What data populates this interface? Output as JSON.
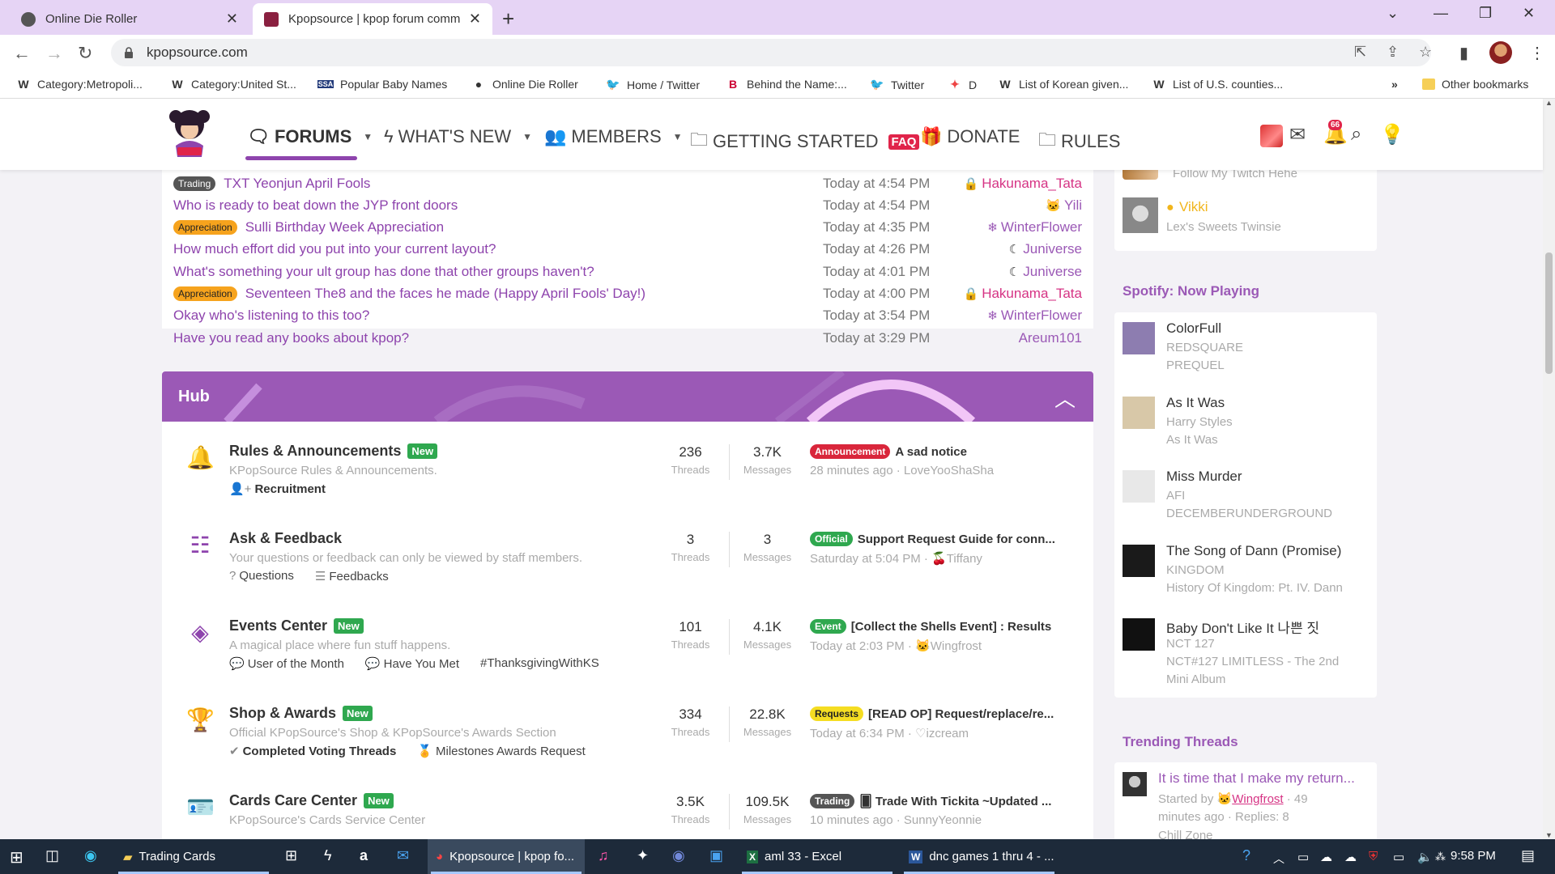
{
  "browser": {
    "tabs": [
      {
        "title": "Online Die Roller",
        "active": false
      },
      {
        "title": "Kpopsource | kpop forum comm",
        "active": true
      }
    ],
    "url": "kpopsource.com",
    "bookmarks": [
      {
        "icon": "W",
        "label": "Category:Metropoli..."
      },
      {
        "icon": "W",
        "label": "Category:United St..."
      },
      {
        "icon": "SSA",
        "label": "Popular Baby Names"
      },
      {
        "icon": "●",
        "label": "Online Die Roller"
      },
      {
        "icon": "🐦",
        "label": "Home / Twitter"
      },
      {
        "icon": "B",
        "label": "Behind the Name:..."
      },
      {
        "icon": "🐦",
        "label": "Twitter"
      },
      {
        "icon": "✦",
        "label": "D"
      },
      {
        "icon": "W",
        "label": "List of Korean given..."
      },
      {
        "icon": "W",
        "label": "List of U.S. counties..."
      }
    ],
    "more_bookmarks": "»",
    "other_bookmarks": "Other bookmarks"
  },
  "nav": {
    "forums": "FORUMS",
    "whats_new": "WHAT'S NEW",
    "members": "MEMBERS",
    "getting_started": "GETTING STARTED",
    "faq": "FAQ",
    "donate": "DONATE",
    "rules": "RULES",
    "alerts_count": "66"
  },
  "new_posts": [
    {
      "label": "Trading",
      "label_type": "trading",
      "title": "TXT Yeonjun April Fools",
      "time": "Today at 4:54 PM",
      "user": "Hakunama_Tata",
      "user_color": "#d63384",
      "user_icon": "lock-icon"
    },
    {
      "label": "",
      "label_type": "",
      "title": "Who is ready to beat down the JYP front doors",
      "time": "Today at 4:54 PM",
      "user": "Yili",
      "user_color": "#9b59b6",
      "user_icon": "cat-icon"
    },
    {
      "label": "Appreciation",
      "label_type": "appreciation",
      "title": "Sulli Birthday Week Appreciation",
      "time": "Today at 4:35 PM",
      "user": "WinterFlower",
      "user_color": "#9b59b6",
      "user_icon": "snowflake-icon"
    },
    {
      "label": "",
      "label_type": "",
      "title": "How much effort did you put into your current layout?",
      "time": "Today at 4:26 PM",
      "user": "Juniverse",
      "user_color": "#9b59b6",
      "user_icon": "moon-icon"
    },
    {
      "label": "",
      "label_type": "",
      "title": "What's something your ult group has done that other groups haven't?",
      "time": "Today at 4:01 PM",
      "user": "Juniverse",
      "user_color": "#9b59b6",
      "user_icon": "moon-icon"
    },
    {
      "label": "Appreciation",
      "label_type": "appreciation",
      "title": "Seventeen The8 and the faces he made (Happy April Fools' Day!)",
      "time": "Today at 4:00 PM",
      "user": "Hakunama_Tata",
      "user_color": "#d63384",
      "user_icon": "lock-icon"
    },
    {
      "label": "",
      "label_type": "",
      "title": "Okay who's listening to this too?",
      "time": "Today at 3:54 PM",
      "user": "WinterFlower",
      "user_color": "#9b59b6",
      "user_icon": "snowflake-icon"
    },
    {
      "label": "",
      "label_type": "",
      "title": "Have you read any books about kpop?",
      "time": "Today at 3:29 PM",
      "user": "Areum101",
      "user_color": "#9b59b6",
      "user_icon": ""
    }
  ],
  "hub": {
    "title": "Hub",
    "forums": [
      {
        "icon": "🔔",
        "name": "Rules & Announcements",
        "new": "New",
        "desc": "KPopSource Rules & Announcements.",
        "subs": [
          {
            "icon": "👤+",
            "label": "Recruitment",
            "bold": true
          }
        ],
        "threads": "236",
        "messages": "3.7K",
        "threads_label": "Threads",
        "messages_label": "Messages",
        "last_label": "Announcement",
        "last_label_type": "announcement",
        "last_title": "A sad notice",
        "last_meta": "28 minutes ago · LoveYooShaSha"
      },
      {
        "icon": "☷",
        "name": "Ask & Feedback",
        "new": "",
        "desc": "Your questions or feedback can only be viewed by staff members.",
        "subs": [
          {
            "icon": "?",
            "label": "Questions",
            "bold": false
          },
          {
            "icon": "☰",
            "label": "Feedbacks",
            "bold": false
          }
        ],
        "threads": "3",
        "messages": "3",
        "threads_label": "Threads",
        "messages_label": "Messages",
        "last_label": "Official",
        "last_label_type": "official",
        "last_title": "Support Request Guide for conn...",
        "last_meta": "Saturday at 5:04 PM · 🍒Tiffany"
      },
      {
        "icon": "◈",
        "name": "Events Center",
        "new": "New",
        "desc": "A magical place where fun stuff happens.",
        "subs": [
          {
            "icon": "💬",
            "label": "User of the Month",
            "bold": false
          },
          {
            "icon": "💬",
            "label": "Have You Met",
            "bold": false
          },
          {
            "icon": "",
            "label": "#ThanksgivingWithKS",
            "bold": false
          }
        ],
        "threads": "101",
        "messages": "4.1K",
        "threads_label": "Threads",
        "messages_label": "Messages",
        "last_label": "Event",
        "last_label_type": "event",
        "last_title": "[Collect the Shells Event] : Results",
        "last_meta": "Today at 2:03 PM · 🐱Wingfrost"
      },
      {
        "icon": "🏆",
        "name": "Shop & Awards",
        "new": "New",
        "desc": "Official KPopSource's Shop & KPopSource's Awards Section",
        "subs": [
          {
            "icon": "✔",
            "label": "Completed Voting Threads",
            "bold": true
          },
          {
            "icon": "🏅",
            "label": "Milestones Awards Request",
            "bold": false
          }
        ],
        "threads": "334",
        "messages": "22.8K",
        "threads_label": "Threads",
        "messages_label": "Messages",
        "last_label": "Requests",
        "last_label_type": "requests",
        "last_title": "[READ OP] Request/replace/re...",
        "last_meta": "Today at 6:34 PM · ♡izcream"
      },
      {
        "icon": "🪪",
        "name": "Cards Care Center",
        "new": "New",
        "desc": "KPopSource's Cards Service Center",
        "subs": [],
        "threads": "3.5K",
        "messages": "109.5K",
        "threads_label": "Threads",
        "messages_label": "Messages",
        "last_label": "Trading",
        "last_label_type": "trading2",
        "last_title": "🂠 Trade With Tickita ~Updated ...",
        "last_meta": "10 minutes ago · SunnyYeonnie"
      }
    ]
  },
  "sidebar": {
    "online_users": [
      {
        "name": "",
        "status": "Follow My Twitch Hehe"
      },
      {
        "name": "Vikki",
        "status": "Lex's Sweets Twinsie"
      }
    ],
    "spotify_title": "Spotify: Now Playing",
    "songs": [
      {
        "title": "ColorFull",
        "artist": "REDSQUARE",
        "album": "PREQUEL",
        "color": "#8d7db0"
      },
      {
        "title": "As It Was",
        "artist": "Harry Styles",
        "album": "As It Was",
        "color": "#d8c8a8"
      },
      {
        "title": "Miss Murder",
        "artist": "AFI",
        "album": "DECEMBERUNDERGROUND",
        "color": "#e8e8e8"
      },
      {
        "title": "The Song of Dann (Promise)",
        "artist": "KINGDOM",
        "album": "History Of Kingdom: Pt. IV. Dann",
        "color": "#1a1a1a"
      },
      {
        "title": "Baby Don't Like It 나쁜 짓",
        "artist": "NCT 127",
        "album": "NCT#127 LIMITLESS - The 2nd",
        "album2": "Mini Album",
        "color": "#111111"
      }
    ],
    "trending_title": "Trending Threads",
    "trending": {
      "title": "It is time that I make my return...",
      "started_by": "Started by",
      "author": "Wingfrost",
      "meta1": "· 49",
      "meta2": "minutes ago · Replies: 8",
      "forum": "Chill Zone"
    }
  },
  "taskbar": {
    "apps": [
      {
        "label": "Trading Cards"
      },
      {
        "label": "Kpopsource | kpop fo..."
      },
      {
        "label": "aml 33 - Excel"
      },
      {
        "label": "dnc games 1 thru 4 - ..."
      }
    ],
    "time": "9:58 PM"
  }
}
